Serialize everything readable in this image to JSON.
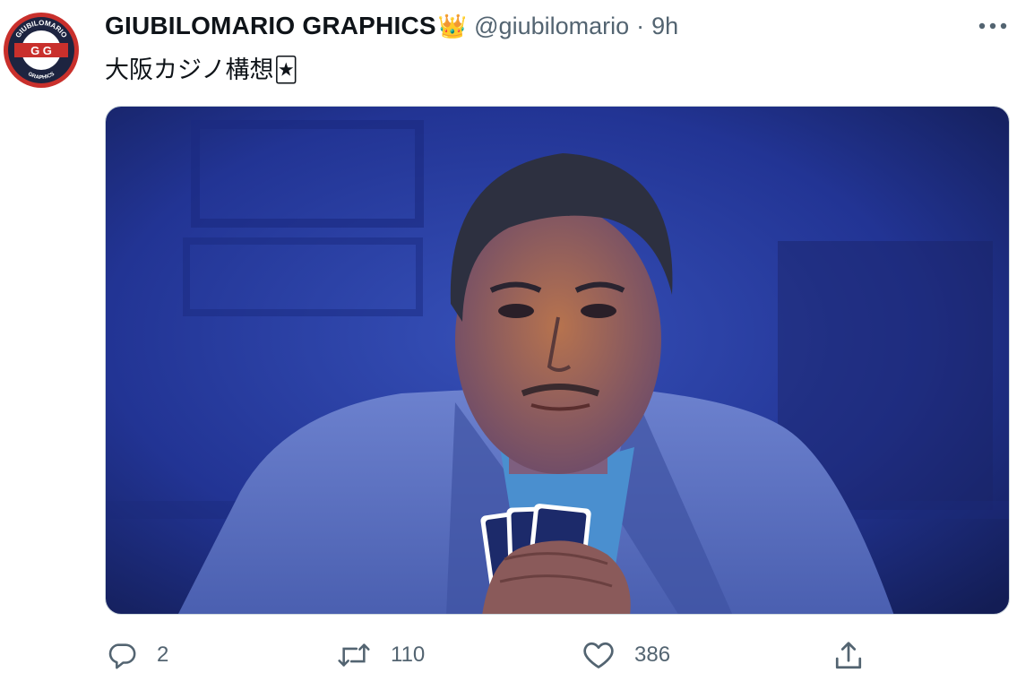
{
  "tweet": {
    "display_name": "GIUBILOMARIO GRAPHICS",
    "badge_emoji": "👑",
    "handle": "@giubilomario",
    "separator": "·",
    "time": "9h",
    "text": "大阪カジノ構想🃏"
  },
  "avatar": {
    "logo_text_top": "GIUBILOMARIO",
    "logo_initials": "G G",
    "logo_text_bottom": "GRAPHICS"
  },
  "actions": {
    "reply_count": "2",
    "retweet_count": "110",
    "like_count": "386"
  },
  "icons": {
    "more": "more-icon",
    "reply": "reply-icon",
    "retweet": "retweet-icon",
    "like": "heart-icon",
    "share": "share-icon"
  },
  "colors": {
    "text_primary": "#0f1419",
    "text_secondary": "#536471",
    "image_blue": "#2a3f9e"
  }
}
